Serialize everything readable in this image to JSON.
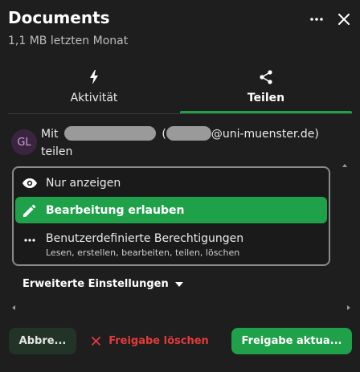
{
  "header": {
    "title": "Documents",
    "subtitle": "1,1 MB letzten Monat"
  },
  "tabs": [
    {
      "label": "Aktivität",
      "icon": "lightning-icon",
      "active": false
    },
    {
      "label": "Teilen",
      "icon": "share-icon",
      "active": true
    }
  ],
  "share": {
    "avatar_initials": "GL",
    "prefix": "Mit",
    "paren_open": "(",
    "email_domain": "@uni-muenster.de)",
    "suffix": "teilen"
  },
  "permissions": {
    "view_label": "Nur anzeigen",
    "edit_label": "Bearbeitung erlauben",
    "custom_label": "Benutzerdefinierte Berechtigungen",
    "custom_sub": "Lesen, erstellen, bearbeiten, teilen, löschen",
    "selected": "edit"
  },
  "advanced": {
    "label": "Erweiterte Einstellungen"
  },
  "footer": {
    "cancel_label": "Abbre...",
    "delete_label": "Freigabe löschen",
    "update_label": "Freigabe aktua..."
  },
  "colors": {
    "accent": "#1fa14a",
    "danger": "#e33a3a",
    "background": "#1e1e1e"
  }
}
